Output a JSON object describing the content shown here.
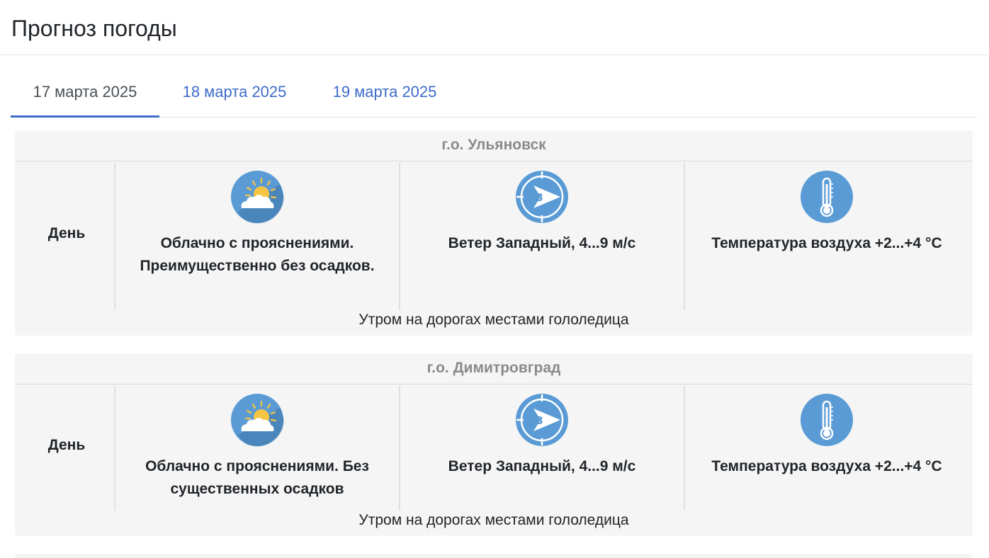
{
  "page": {
    "title": "Прогноз погоды"
  },
  "tabs": [
    {
      "label": "17 марта 2025",
      "active": true
    },
    {
      "label": "18 марта 2025",
      "active": false
    },
    {
      "label": "19 марта 2025",
      "active": false
    }
  ],
  "colors": {
    "accent": "#3d6bc8",
    "icon_bg": "#5a9bd5",
    "card_bg": "#f5f5f5",
    "sun": "#f6c543"
  },
  "icons": {
    "weather": "partly-cloudy-icon",
    "wind": "wind-direction-icon",
    "temperature": "thermometer-icon"
  },
  "forecasts": [
    {
      "city": "г.о. Ульяновск",
      "period": "День",
      "weather": "Облачно с прояснениями. Преимущественно без осадков.",
      "wind": "Ветер Западный, 4...9 м/с",
      "wind_dir_letter": "З",
      "temperature": "Температура воздуха +2...+4 °С",
      "note": "Утром на дорогах местами гололедица"
    },
    {
      "city": "г.о. Димитровград",
      "period": "День",
      "weather": "Облачно с прояснениями. Без существенных осадков",
      "wind": "Ветер Западный, 4...9 м/с",
      "wind_dir_letter": "З",
      "temperature": "Температура воздуха +2...+4 °С",
      "note": "Утром на дорогах местами гололедица"
    }
  ]
}
